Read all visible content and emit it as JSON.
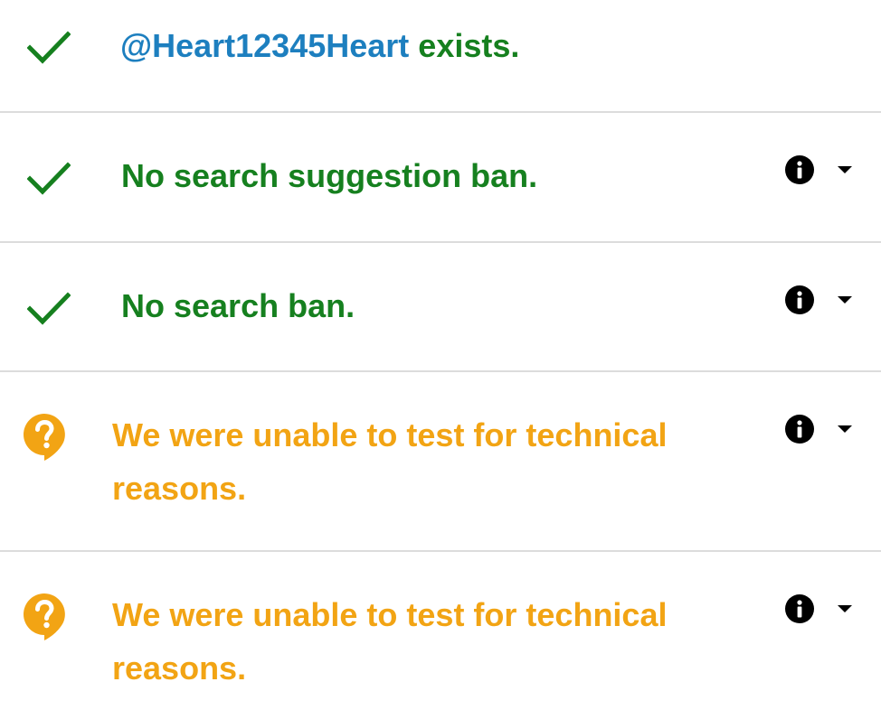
{
  "colors": {
    "success": "#16801f",
    "warning": "#f2a414",
    "handle": "#1d7fbf",
    "divider": "#dcdcdc",
    "icon": "#000000"
  },
  "rows": [
    {
      "status": "success",
      "icon": "check-icon",
      "handle": "@Heart12345Heart",
      "text": " exists.",
      "has_details": false
    },
    {
      "status": "success",
      "icon": "check-icon",
      "text": "No search suggestion ban.",
      "has_details": true,
      "info_icon": "info-icon",
      "toggle_icon": "caret-down-icon"
    },
    {
      "status": "success",
      "icon": "check-icon",
      "text": "No search ban.",
      "has_details": true,
      "info_icon": "info-icon",
      "toggle_icon": "caret-down-icon"
    },
    {
      "status": "unknown",
      "icon": "question-bubble-icon",
      "text_line1": "We were unable to test for technical",
      "text_line2": "reasons.",
      "has_details": true,
      "info_icon": "info-icon",
      "toggle_icon": "caret-down-icon"
    },
    {
      "status": "unknown",
      "icon": "question-bubble-icon",
      "text_line1": "We were unable to test for technical",
      "text_line2": "reasons.",
      "has_details": true,
      "info_icon": "info-icon",
      "toggle_icon": "caret-down-icon"
    }
  ]
}
